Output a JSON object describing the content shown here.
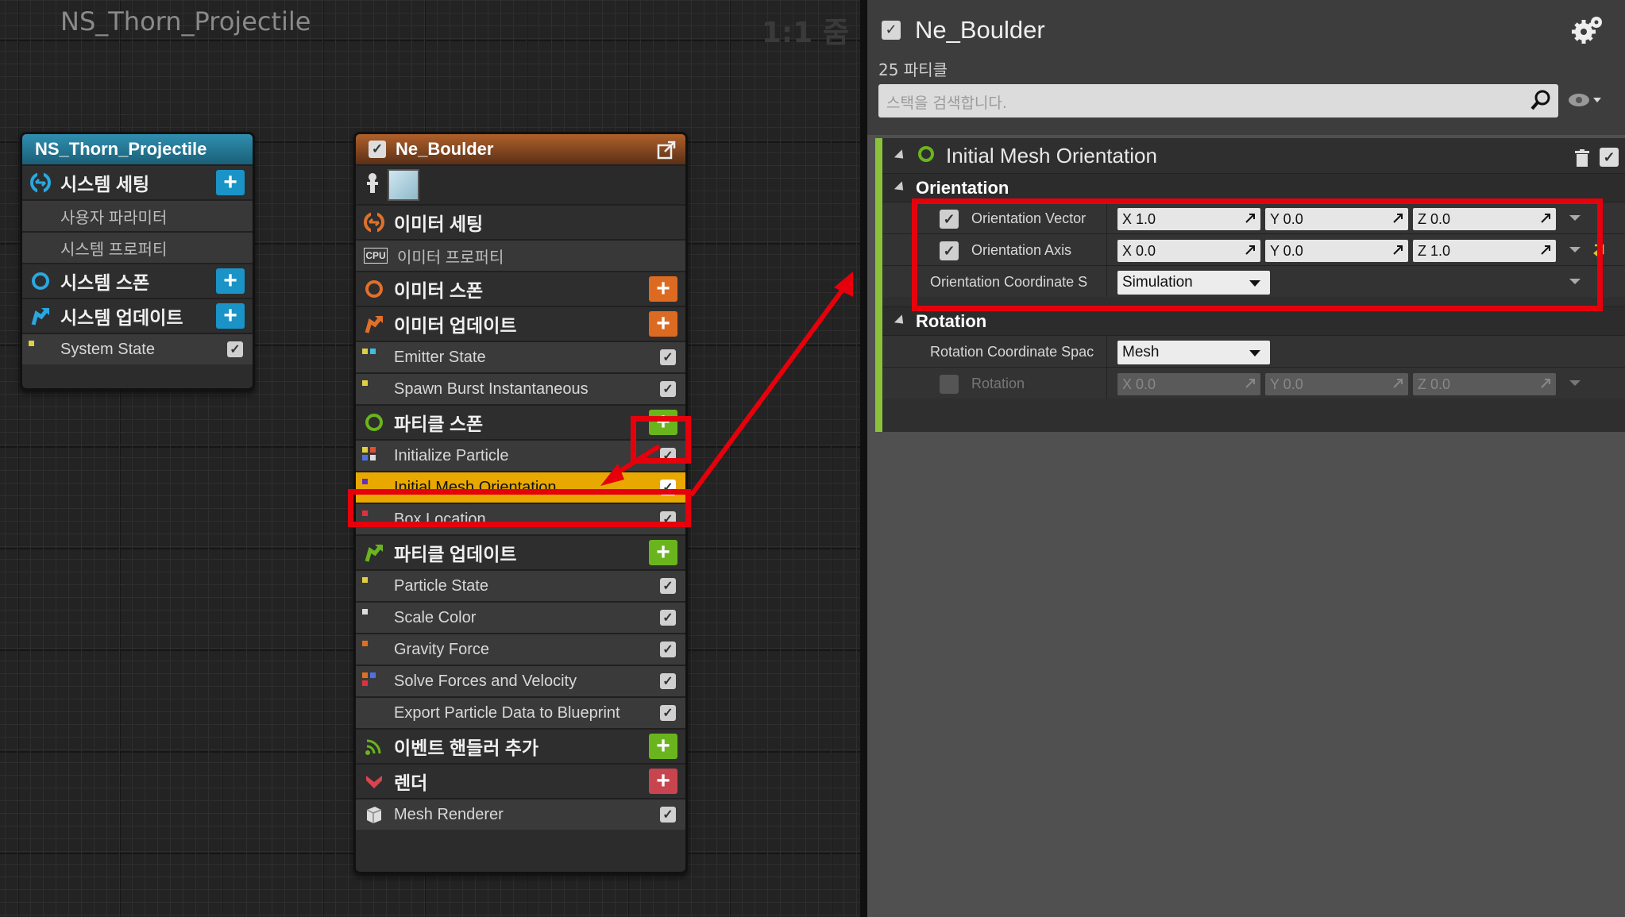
{
  "graph": {
    "title": "NS_Thorn_Projectile",
    "zoom": "1:1 줌"
  },
  "system_node": {
    "title": "NS_Thorn_Projectile",
    "rows": [
      {
        "label": "시스템 세팅"
      },
      {
        "label": "사용자 파라미터"
      },
      {
        "label": "시스템 프로퍼티"
      },
      {
        "label": "시스템 스폰"
      },
      {
        "label": "시스템 업데이트"
      },
      {
        "label": "System State"
      }
    ]
  },
  "emitter_node": {
    "title": "Ne_Boulder",
    "rows": [
      {
        "label": "이미터 세팅"
      },
      {
        "label": "이미터 프로퍼티"
      },
      {
        "label": "이미터 스폰"
      },
      {
        "label": "이미터 업데이트"
      },
      {
        "label": "Emitter State"
      },
      {
        "label": "Spawn Burst Instantaneous"
      },
      {
        "label": "파티클 스폰"
      },
      {
        "label": "Initialize Particle"
      },
      {
        "label": "Initial Mesh Orientation"
      },
      {
        "label": "Box Location"
      },
      {
        "label": "파티클 업데이트"
      },
      {
        "label": "Particle State"
      },
      {
        "label": "Scale Color"
      },
      {
        "label": "Gravity Force"
      },
      {
        "label": "Solve Forces and Velocity"
      },
      {
        "label": "Export Particle Data to Blueprint"
      },
      {
        "label": "이벤트 핸들러 추가"
      },
      {
        "label": "렌더"
      },
      {
        "label": "Mesh Renderer"
      }
    ],
    "cpu_badge": "CPU"
  },
  "panel": {
    "title": "Ne_Boulder",
    "particle_count": "25 파티클",
    "search_placeholder": "스택을 검색합니다.",
    "module": {
      "title": "Initial Mesh Orientation",
      "categories": [
        {
          "name": "Orientation",
          "props": [
            {
              "name": "Orientation Vector",
              "x": "X 1.0",
              "y": "Y 0.0",
              "z": "Z 0.0"
            },
            {
              "name": "Orientation Axis",
              "x": "X 0.0",
              "y": "Y 0.0",
              "z": "Z 1.0"
            },
            {
              "name": "Orientation Coordinate S",
              "value": "Simulation"
            }
          ]
        },
        {
          "name": "Rotation",
          "props": [
            {
              "name": "Rotation Coordinate Spac",
              "value": "Mesh"
            },
            {
              "name": "Rotation",
              "x": "X 0.0",
              "y": "Y 0.0",
              "z": "Z 0.0"
            }
          ]
        }
      ]
    }
  },
  "colors": {
    "highlight": "#e5000c",
    "selected": "#e8a800",
    "module_accent": "#8ac33a"
  }
}
